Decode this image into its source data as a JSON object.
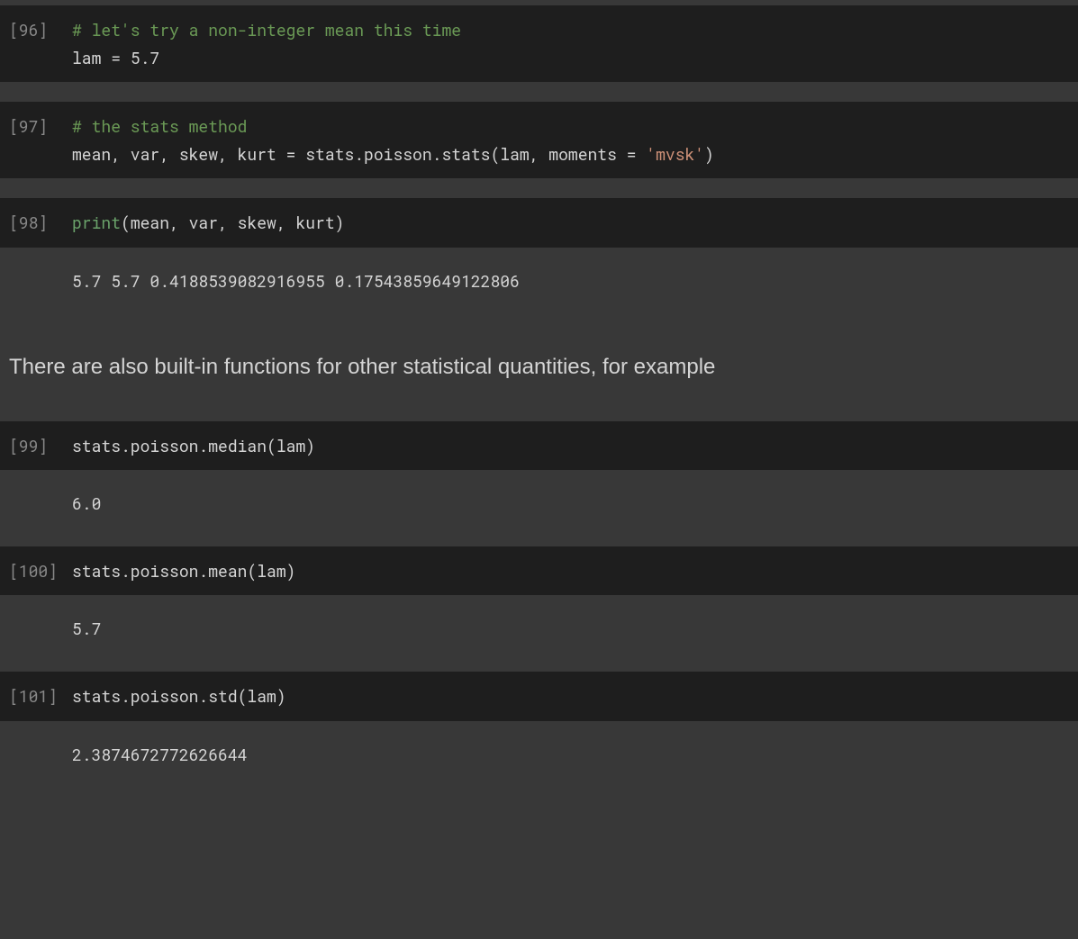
{
  "cells": {
    "c96": {
      "prompt": "[96]",
      "line1_comment": "# let's try a non-integer mean this time",
      "line2_var": "lam",
      "line2_eq": " = ",
      "line2_num": "5.7"
    },
    "c97": {
      "prompt": "[97]",
      "line1_comment": "# the stats method",
      "line2_lhs": "mean, var, skew, kurt = stats.poisson.stats(lam, moments = ",
      "line2_str": "'mvsk'",
      "line2_close": ")"
    },
    "c98": {
      "prompt": "[98]",
      "print_kw": "print",
      "print_args": "(mean, var, skew, kurt)",
      "output": "5.7 5.7 0.4188539082916955 0.17543859649122806"
    },
    "md1": {
      "text": "There are also built-in functions for other statistical quantities, for example"
    },
    "c99": {
      "prompt": "[99]",
      "code": "stats.poisson.median(lam)",
      "output": "6.0"
    },
    "c100": {
      "prompt": "[100]",
      "code": "stats.poisson.mean(lam)",
      "output": "5.7"
    },
    "c101": {
      "prompt": "[101]",
      "code": "stats.poisson.std(lam)",
      "output": "2.3874672772626644"
    }
  }
}
